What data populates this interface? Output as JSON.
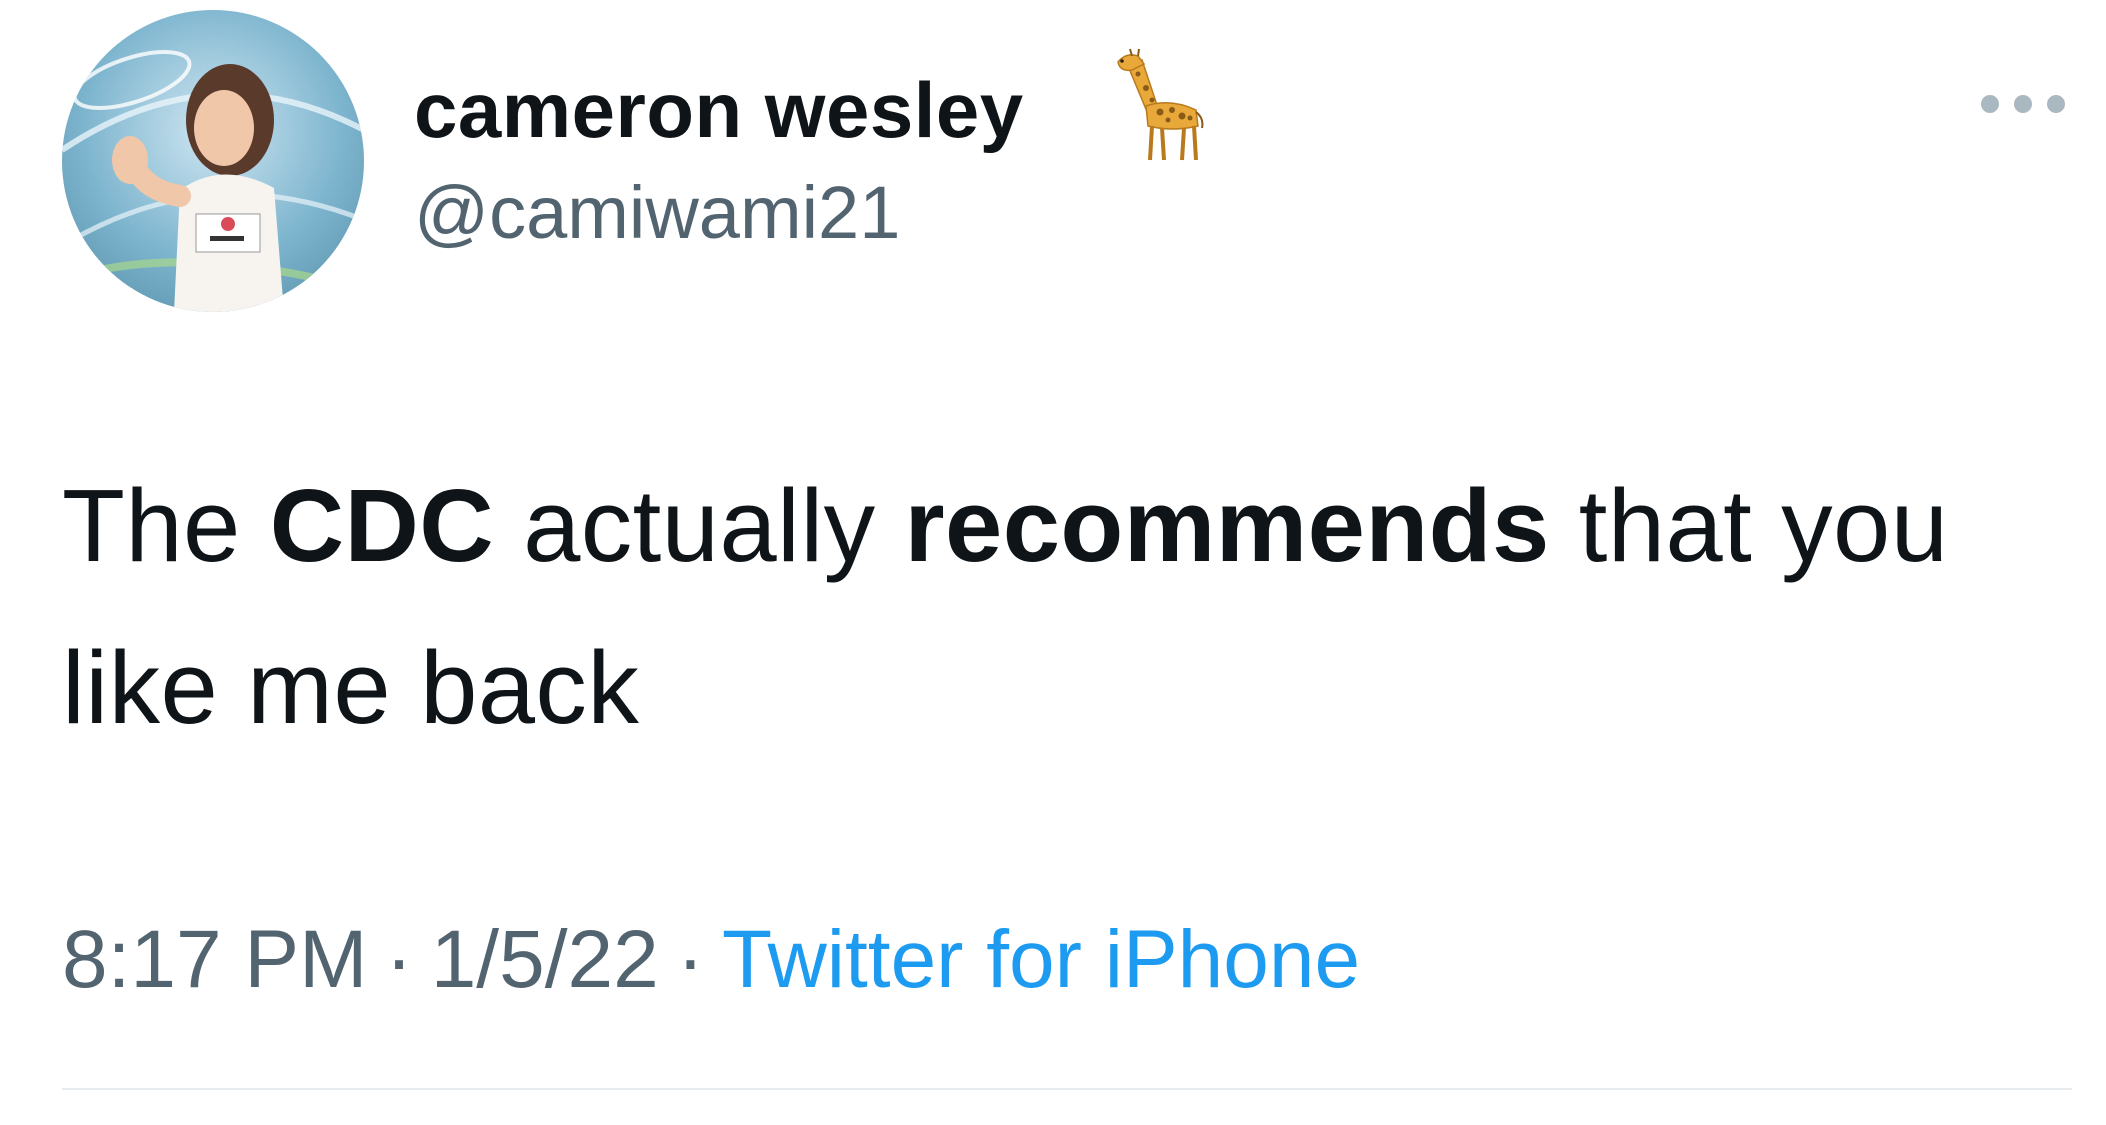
{
  "author": {
    "display_name": "cameron wesley",
    "name_emoji": "giraffe-icon",
    "handle": "@camiwami21",
    "avatar_icon": "avatar-photo"
  },
  "tweet": {
    "text_segments": [
      {
        "text": "The ",
        "bold": false
      },
      {
        "text": "CDC",
        "bold": true
      },
      {
        "text": " actually ",
        "bold": false
      },
      {
        "text": "recommends",
        "bold": true
      },
      {
        "text": " that you like me back",
        "bold": false
      }
    ]
  },
  "meta": {
    "time": "8:17 PM",
    "separator": "·",
    "date": "1/5/22",
    "source": "Twitter for iPhone"
  },
  "colors": {
    "text_primary": "#0f1419",
    "text_secondary": "#536471",
    "link": "#1d9bf0",
    "divider": "#e6ecf0"
  }
}
